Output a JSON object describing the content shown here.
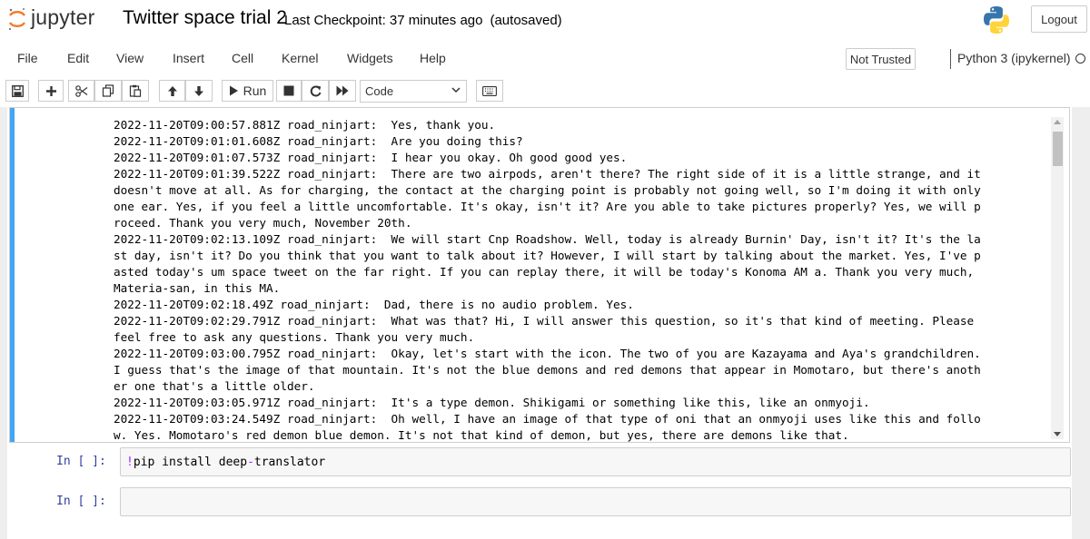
{
  "header": {
    "logo_text": "jupyter",
    "notebook_title": "Twitter space trial 2",
    "checkpoint": "Last Checkpoint: 37 minutes ago",
    "autosave": "(autosaved)",
    "logout_label": "Logout"
  },
  "menubar": {
    "items": [
      "File",
      "Edit",
      "View",
      "Insert",
      "Cell",
      "Kernel",
      "Widgets",
      "Help"
    ],
    "trust_label": "Not Trusted",
    "kernel_name": "Python 3 (ipykernel)"
  },
  "toolbar": {
    "run_label": "Run",
    "cell_type": "Code"
  },
  "output": {
    "lines": [
      "2022-11-20T09:00:57.881Z road_ninjart:  Yes, thank you.",
      "2022-11-20T09:01:01.608Z road_ninjart:  Are you doing this?",
      "2022-11-20T09:01:07.573Z road_ninjart:  I hear you okay. Oh good good yes.",
      "2022-11-20T09:01:39.522Z road_ninjart:  There are two airpods, aren't there? The right side of it is a little strange, and it",
      "doesn't move at all. As for charging, the contact at the charging point is probably not going well, so I'm doing it with only",
      "one ear. Yes, if you feel a little uncomfortable. It's okay, isn't it? Are you able to take pictures properly? Yes, we will p",
      "roceed. Thank you very much, November 20th.",
      "2022-11-20T09:02:13.109Z road_ninjart:  We will start Cnp Roadshow. Well, today is already Burnin' Day, isn't it? It's the la",
      "st day, isn't it? Do you think that you want to talk about it? However, I will start by talking about the market. Yes, I've p",
      "asted today's um space tweet on the far right. If you can replay there, it will be today's Konoma AM a. Thank you very much,",
      "Materia-san, in this MA.",
      "2022-11-20T09:02:18.49Z road_ninjart:  Dad, there is no audio problem. Yes.",
      "2022-11-20T09:02:29.791Z road_ninjart:  What was that? Hi, I will answer this question, so it's that kind of meeting. Please",
      "feel free to ask any questions. Thank you very much.",
      "2022-11-20T09:03:00.795Z road_ninjart:  Okay, let's start with the icon. The two of you are Kazayama and Aya's grandchildren.",
      "I guess that's the image of that mountain. It's not the blue demons and red demons that appear in Momotaro, but there's anoth",
      "er one that's a little older.",
      "2022-11-20T09:03:05.971Z road_ninjart:  It's a type demon. Shikigami or something like this, like an onmyoji.",
      "2022-11-20T09:03:24.549Z road_ninjart:  Oh well, I have an image of that type of oni that an onmyoji uses like this and follo",
      "w. Yes. Momotaro's red demon blue demon. It's not that kind of demon, but yes, there are demons like that."
    ]
  },
  "cells": [
    {
      "prompt": "In [ ]:",
      "bang": "!",
      "cmd": "pip install deep",
      "op": "-",
      "rest": "translator"
    },
    {
      "prompt": "In [ ]:",
      "code": ""
    }
  ],
  "colors": {
    "selected_bar": "#42a5f5",
    "prompt_blue": "#303f9f",
    "python_blue": "#3776ab",
    "python_yellow": "#ffd43b",
    "jupyter_orange": "#f37726"
  }
}
